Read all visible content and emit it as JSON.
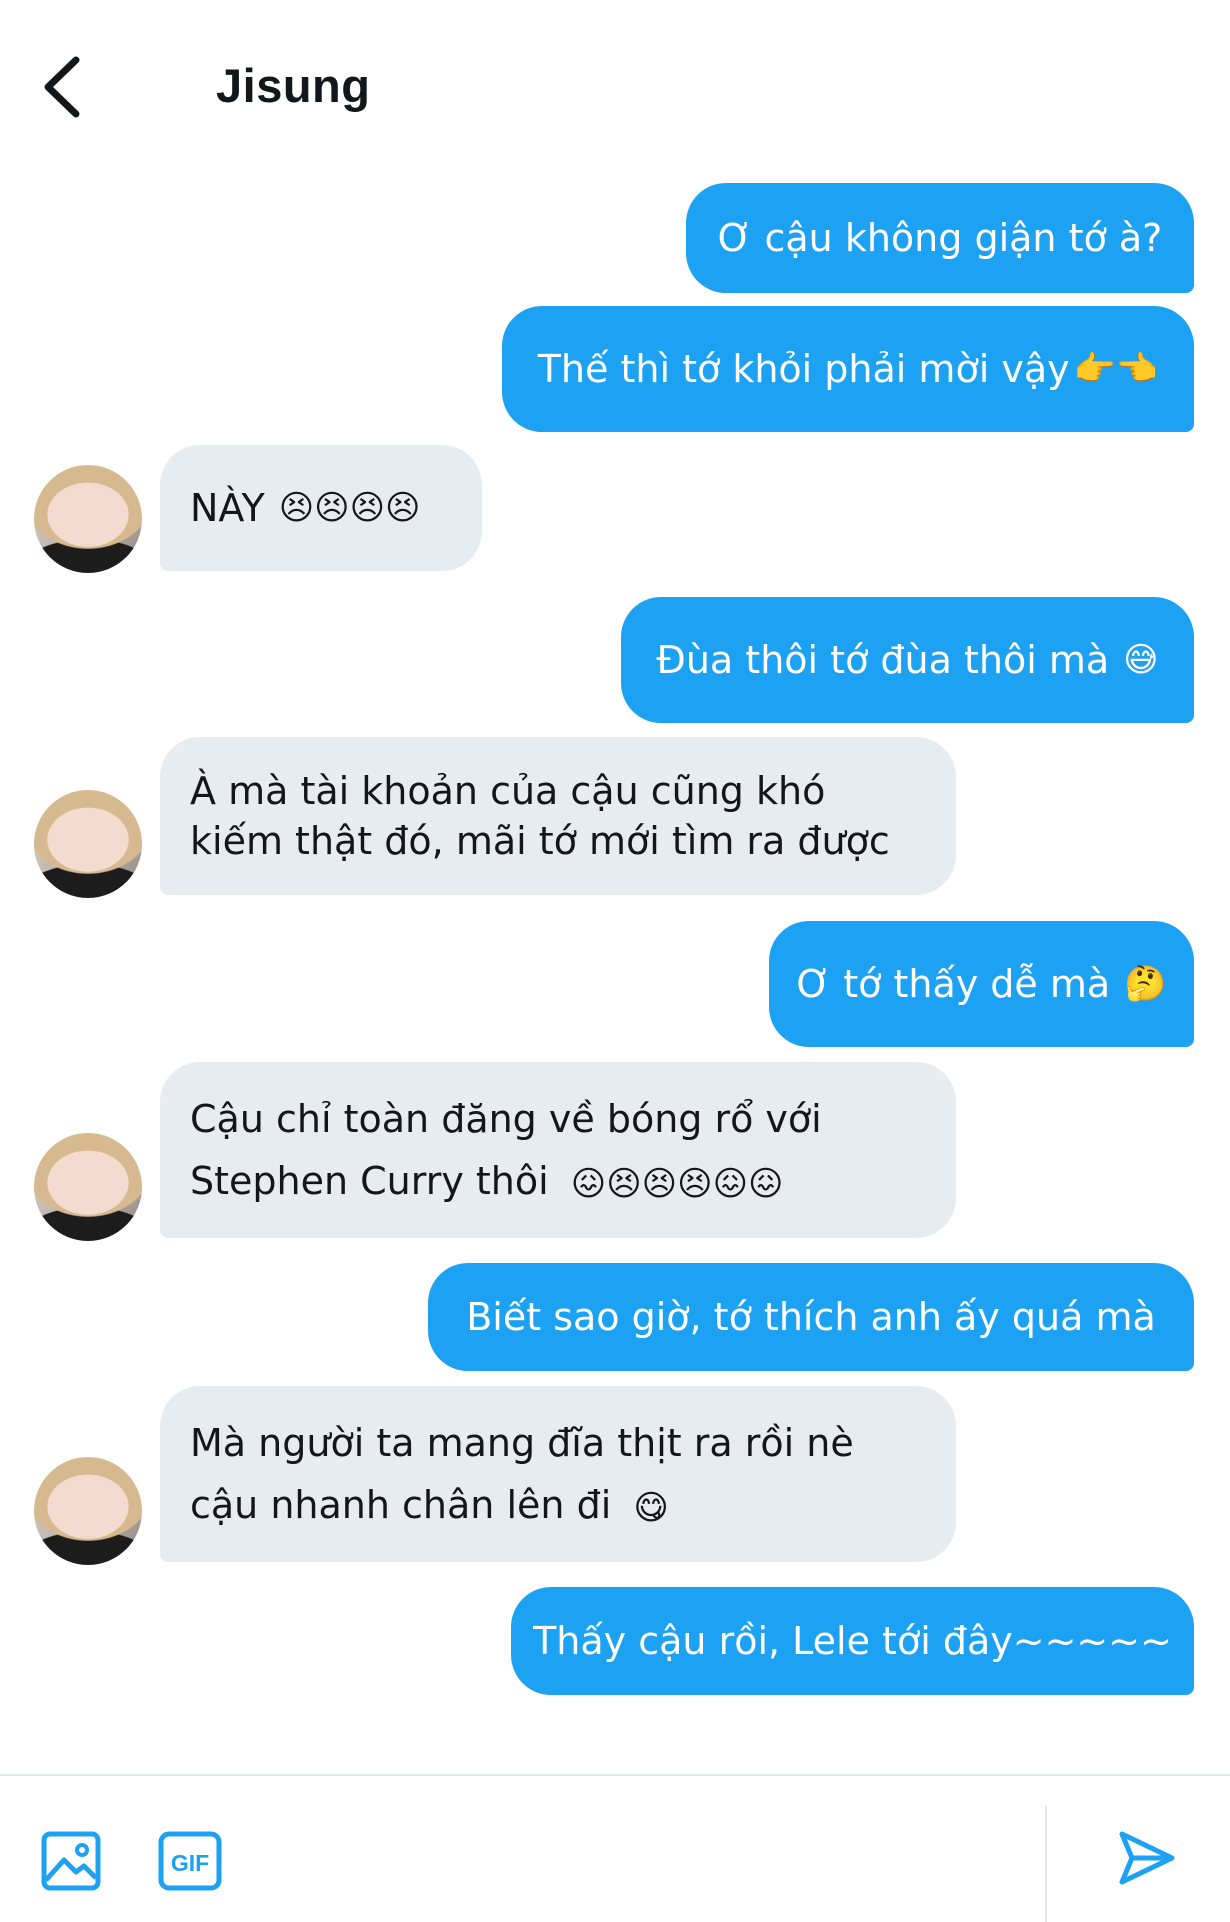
{
  "header": {
    "title": "Jisung",
    "back_icon": "chevron-left-icon"
  },
  "colors": {
    "sent_bubble": "#1da1f2",
    "received_bubble": "#e6ecf0",
    "accent": "#1da1f2"
  },
  "messages": [
    {
      "from": "me",
      "text": "Ơ cậu không giận tớ à?"
    },
    {
      "from": "me",
      "text": "Thế thì tớ khỏi phải mời vậy",
      "emoji": "👉👈"
    },
    {
      "from": "them",
      "text": "NÀY",
      "emoji": "😣😣😣😣"
    },
    {
      "from": "me",
      "text": "Đùa thôi tớ đùa thôi mà",
      "emoji": "😅"
    },
    {
      "from": "them",
      "lines": [
        "À mà tài khoản của cậu cũng khó",
        "kiếm thật đó, mãi tớ mới tìm ra được"
      ]
    },
    {
      "from": "me",
      "text": "Ơ tớ thấy dễ mà",
      "emoji": "🤔"
    },
    {
      "from": "them",
      "lines": [
        "Cậu chỉ toàn đăng về bóng rổ với",
        "Stephen Curry thôi"
      ],
      "emoji": "😖😣😣😣😖😖"
    },
    {
      "from": "me",
      "text": "Biết sao giờ, tớ thích anh ấy quá mà"
    },
    {
      "from": "them",
      "lines": [
        "Mà người ta mang đĩa thịt ra rồi nè",
        "cậu nhanh chân lên đi"
      ],
      "emoji": "😋"
    },
    {
      "from": "me",
      "text": "Thấy cậu rồi, Lele tới đây~~~~~"
    }
  ],
  "composer": {
    "image_icon": "image-icon",
    "gif_label": "GIF",
    "send_icon": "send-icon"
  }
}
